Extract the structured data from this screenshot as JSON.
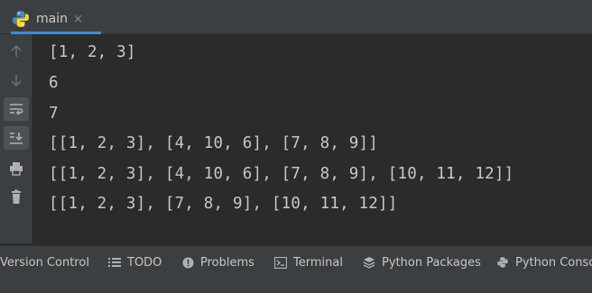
{
  "tab": {
    "title": "main",
    "close_glyph": "×",
    "icon": "python-icon"
  },
  "sidebar": {
    "buttons": [
      {
        "name": "up-arrow-icon",
        "active": false
      },
      {
        "name": "down-arrow-icon",
        "active": false
      },
      {
        "name": "soft-wrap-icon",
        "active": true
      },
      {
        "name": "scroll-to-end-icon",
        "active": true
      },
      {
        "name": "print-icon",
        "active": false
      },
      {
        "name": "trash-icon",
        "active": false
      }
    ]
  },
  "console": {
    "lines": [
      "[1, 2, 3]",
      "6",
      "7",
      "[[1, 2, 3], [4, 10, 6], [7, 8, 9]]",
      "[[1, 2, 3], [4, 10, 6], [7, 8, 9], [10, 11, 12]]",
      "[[1, 2, 3], [7, 8, 9], [10, 11, 12]]"
    ]
  },
  "bottom_tabs": [
    {
      "label": "Version Control",
      "icon": ""
    },
    {
      "label": "TODO",
      "icon": "list-icon"
    },
    {
      "label": "Problems",
      "icon": "problems-icon"
    },
    {
      "label": "Terminal",
      "icon": "terminal-icon"
    },
    {
      "label": "Python Packages",
      "icon": "packages-icon"
    },
    {
      "label": "Python Console",
      "icon": "python-console-icon"
    }
  ],
  "colors": {
    "accent": "#4a88c7",
    "panel": "#3c3f41",
    "editor_bg": "#2b2b2b",
    "text": "#c7c7c7"
  }
}
